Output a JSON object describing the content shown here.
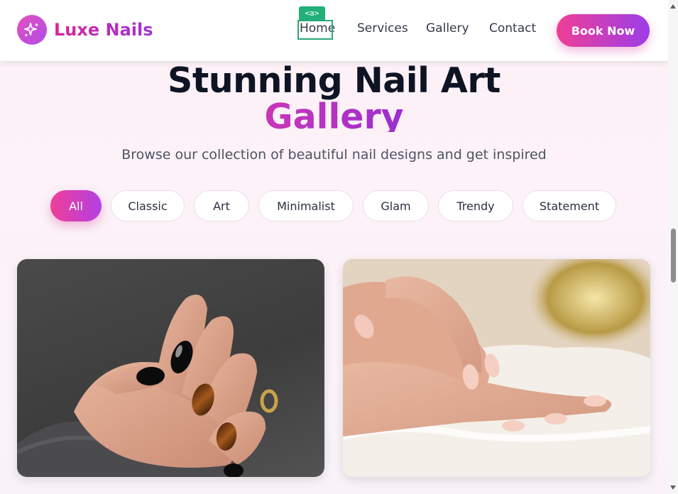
{
  "brand": {
    "name": "Luxe Nails",
    "logo_icon": "sparkles-icon"
  },
  "nav": {
    "items": [
      {
        "label": "Home"
      },
      {
        "label": "Services"
      },
      {
        "label": "Gallery"
      },
      {
        "label": "Contact"
      }
    ],
    "cta_label": "Book Now"
  },
  "inspector": {
    "tag_label": "<a>"
  },
  "hero": {
    "title_line1": "Stunning Nail Art",
    "title_line2": "Gallery",
    "subtitle": "Browse our collection of beautiful nail designs and get inspired"
  },
  "filters": {
    "active": "All",
    "items": [
      "All",
      "Classic",
      "Art",
      "Minimalist",
      "Glam",
      "Trendy",
      "Statement"
    ]
  },
  "gallery": {
    "items": [
      {
        "alt": "black and tortoiseshell nails",
        "icon": "photo-dark-manicure"
      },
      {
        "alt": "nude pink manicure",
        "icon": "photo-nude-manicure"
      }
    ]
  },
  "colors": {
    "brand_gradient_start": "#ef3e96",
    "brand_gradient_end": "#9c3de8",
    "focus_outline": "#2aa876",
    "title_text": "#0f1424"
  }
}
